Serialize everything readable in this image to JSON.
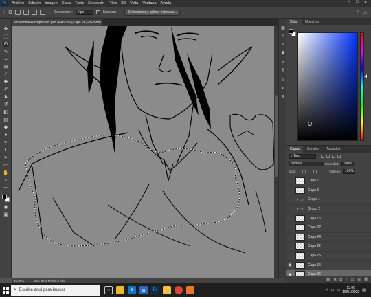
{
  "app": {
    "logo": "Ps",
    "menu": [
      "Archivo",
      "Edición",
      "Imagen",
      "Capa",
      "Texto",
      "Selección",
      "Filtro",
      "3D",
      "Vista",
      "Ventana",
      "Ayuda"
    ]
  },
  "options": {
    "feather_label": "Desvanecer:",
    "feather_value": "0 px",
    "smooth_label": "Suavizar",
    "select_mask_button": "Seleccionar y aplicar máscara..."
  },
  "document": {
    "tab_title": "wo all final-Recuperado.psd al 45,9% (Capa 26, RGB/8#) *",
    "zoom": "45,89%",
    "doc_info": "Doc: 80,4 M/300,0 M/3"
  },
  "panels": {
    "color_tabs": [
      "Color",
      "Muestras"
    ],
    "layers_tabs": [
      "Capas",
      "Canales",
      "Trazados"
    ],
    "filter_kind": "Tipo",
    "blend_mode": "Normal",
    "opacity_label": "Opacidad:",
    "opacity_value": "100%",
    "lock_label": "Bloq.:",
    "fill_label": "Relleno:",
    "fill_value": "100%"
  },
  "layers": [
    {
      "name": "Capa 7",
      "type": "layer",
      "visible": false
    },
    {
      "name": "Capa 6",
      "type": "layer",
      "visible": false
    },
    {
      "name": "Grupo 1",
      "type": "group",
      "visible": false
    },
    {
      "name": "Grupo 2",
      "type": "group",
      "visible": false
    },
    {
      "name": "Capa 16",
      "type": "layer",
      "visible": false
    },
    {
      "name": "Capa 22",
      "type": "layer",
      "visible": false
    },
    {
      "name": "Capa 24",
      "type": "layer",
      "visible": false
    },
    {
      "name": "Capa 22",
      "type": "layer",
      "visible": false
    },
    {
      "name": "Capa 25",
      "type": "layer",
      "visible": false
    },
    {
      "name": "Capa 14",
      "type": "layer",
      "visible": true
    },
    {
      "name": "Capa 26",
      "type": "layer",
      "visible": true,
      "selected": true
    }
  ],
  "colors": {
    "foreground": "#000000",
    "background": "#ffffff"
  },
  "taskbar": {
    "search_placeholder": "Escribe aquí para buscar",
    "time": "13:00",
    "date": "16/01/2020"
  }
}
